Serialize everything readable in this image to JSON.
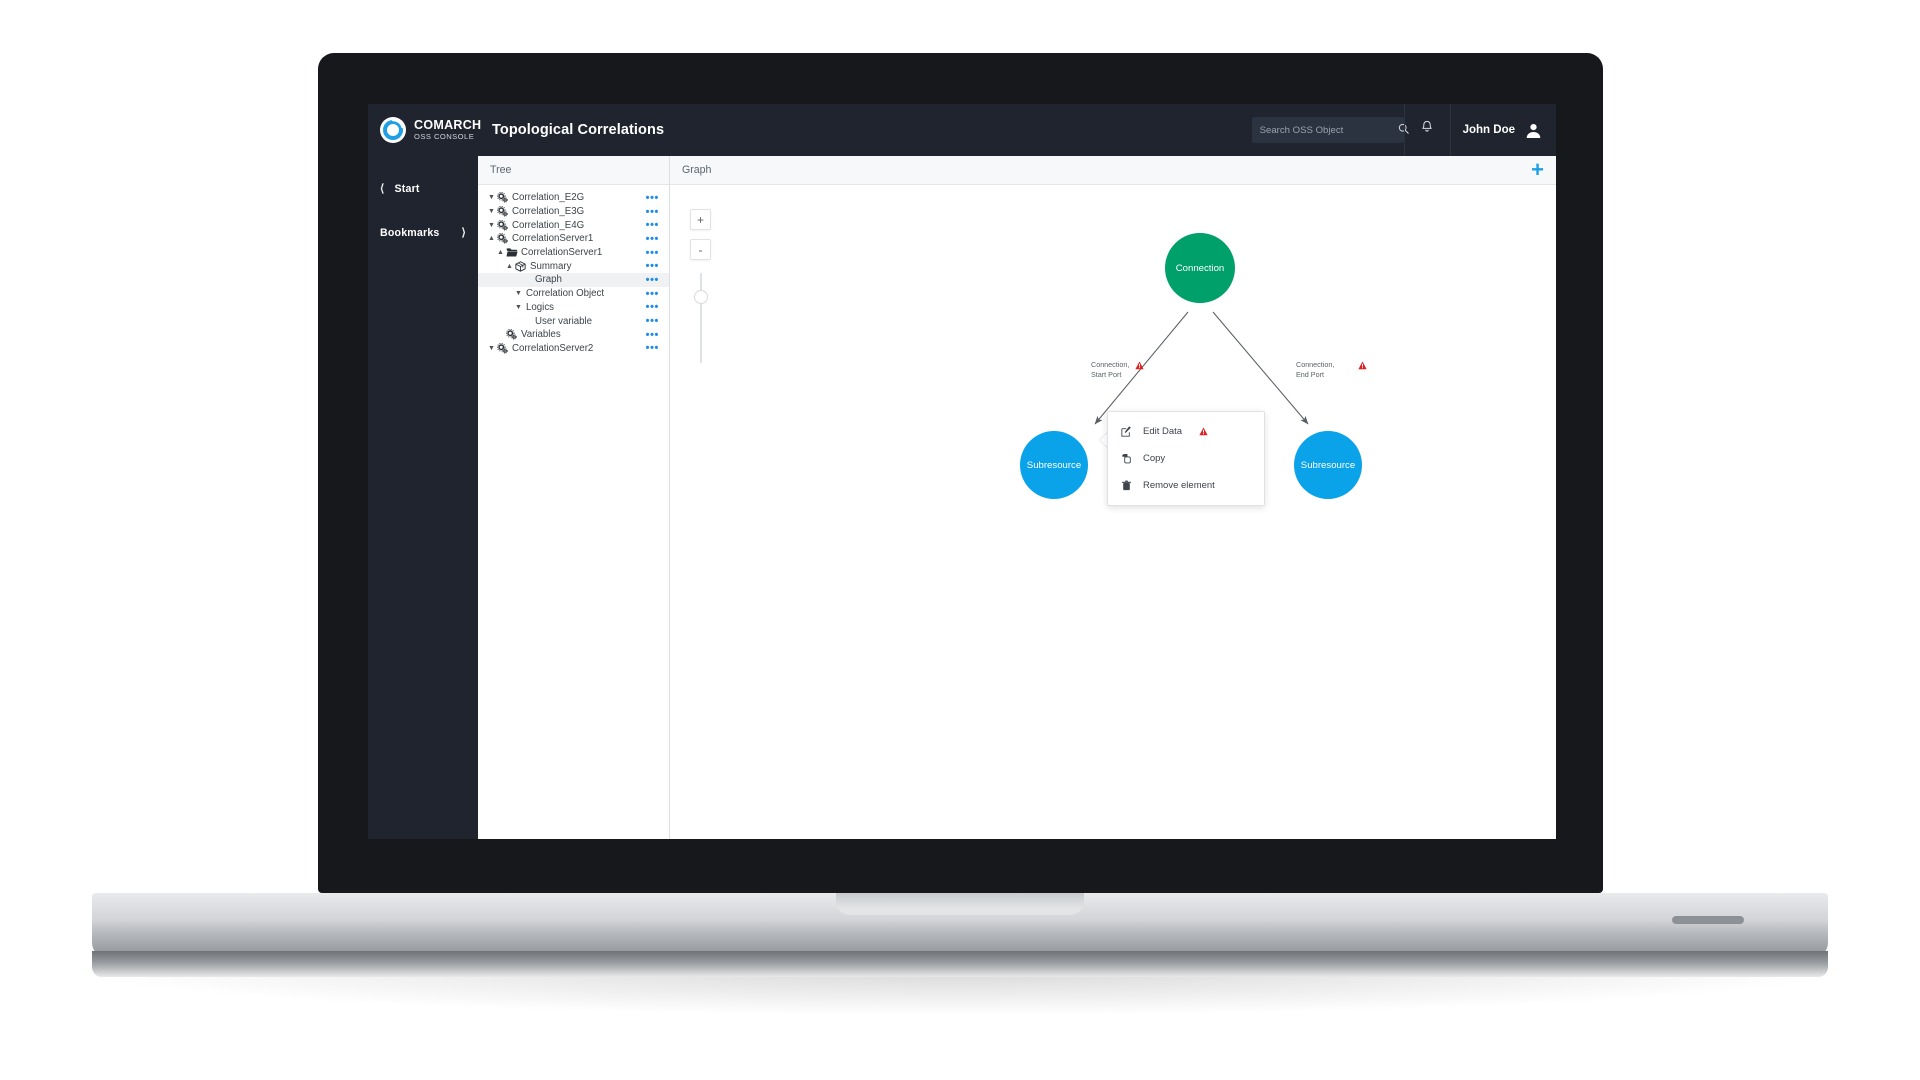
{
  "brand": {
    "name": "COMARCH",
    "subtitle": "OSS CONSOLE",
    "logo_icon": "comarch-ring-logo"
  },
  "header": {
    "title": "Topological Correlations",
    "search": {
      "placeholder": "Search OSS Object",
      "value": "",
      "icon": "search-icon"
    },
    "notifications_icon": "bell-icon",
    "user": {
      "name": "John Doe",
      "avatar_icon": "user-avatar-icon"
    }
  },
  "sidebar": {
    "items": [
      {
        "label": "Start",
        "icon": "chevron-left-icon",
        "icon_side": "left"
      },
      {
        "label": "Bookmarks",
        "icon": "chevron-right-icon",
        "icon_side": "right"
      }
    ]
  },
  "tree_panel": {
    "title": "Tree",
    "row_menu_icon": "ellipsis-icon",
    "items": [
      {
        "label": "Correlation_E2G",
        "indent": 0,
        "caret": "down",
        "icon": "gears-icon",
        "selected": false,
        "menu": true
      },
      {
        "label": "Correlation_E3G",
        "indent": 0,
        "caret": "down",
        "icon": "gears-icon",
        "selected": false,
        "menu": true
      },
      {
        "label": "Correlation_E4G",
        "indent": 0,
        "caret": "down",
        "icon": "gears-icon",
        "selected": false,
        "menu": true
      },
      {
        "label": "CorrelationServer1",
        "indent": 0,
        "caret": "up",
        "icon": "gears-icon",
        "selected": false,
        "menu": true
      },
      {
        "label": "CorrelationServer1",
        "indent": 1,
        "caret": "up",
        "icon": "folder-icon",
        "selected": false,
        "menu": true
      },
      {
        "label": "Summary",
        "indent": 2,
        "caret": "up",
        "icon": "cube-icon",
        "selected": false,
        "menu": true
      },
      {
        "label": "Graph",
        "indent": 4,
        "caret": "none",
        "icon": "none",
        "selected": true,
        "menu": true
      },
      {
        "label": "Correlation Object",
        "indent": 3,
        "caret": "down",
        "icon": "none",
        "selected": false,
        "menu": true
      },
      {
        "label": "Logics",
        "indent": 3,
        "caret": "down",
        "icon": "none",
        "selected": false,
        "menu": true
      },
      {
        "label": "User variable",
        "indent": 4,
        "caret": "none",
        "icon": "none",
        "selected": false,
        "menu": true
      },
      {
        "label": "Variables",
        "indent": 1,
        "caret": "none",
        "icon": "gears-icon",
        "selected": false,
        "menu": true
      },
      {
        "label": "CorrelationServer2",
        "indent": 0,
        "caret": "down",
        "icon": "gears-icon",
        "selected": false,
        "menu": true
      }
    ]
  },
  "graph_panel": {
    "title": "Graph",
    "add_button_label": "+",
    "zoom_controls": {
      "zoom_in_label": "+",
      "zoom_out_label": "-",
      "slider_position_percent": 20
    },
    "nodes": [
      {
        "id": "connection",
        "label": "Connection",
        "color": "#00a06a",
        "shape": "circle"
      },
      {
        "id": "subresource_left",
        "label": "Subresource",
        "color": "#0aa2e8",
        "shape": "circle"
      },
      {
        "id": "subresource_right",
        "label": "Subresource",
        "color": "#0aa2e8",
        "shape": "circle"
      }
    ],
    "edges": [
      {
        "from": "connection",
        "to": "subresource_left",
        "label_line1": "Connection,",
        "label_line2": "Start Port",
        "warning": true,
        "warning_icon": "warning-triangle-icon"
      },
      {
        "from": "connection",
        "to": "subresource_right",
        "label_line1": "Connection,",
        "label_line2": "End Port",
        "warning": true,
        "warning_icon": "warning-triangle-icon"
      }
    ],
    "context_menu": {
      "items": [
        {
          "label": "Edit Data",
          "icon": "edit-pencil-icon",
          "warning": true,
          "warning_icon": "warning-triangle-icon"
        },
        {
          "label": "Copy",
          "icon": "copy-icon",
          "warning": false
        },
        {
          "label": "Remove element",
          "icon": "trash-bin-icon",
          "warning": false
        }
      ]
    }
  },
  "colors": {
    "topbar": "#20242e",
    "accent_blue": "#1f9fe6",
    "node_green": "#00a06a",
    "node_blue": "#0aa2e8",
    "warning_red": "#e02020",
    "tree_dots_blue": "#1f8ceb"
  }
}
